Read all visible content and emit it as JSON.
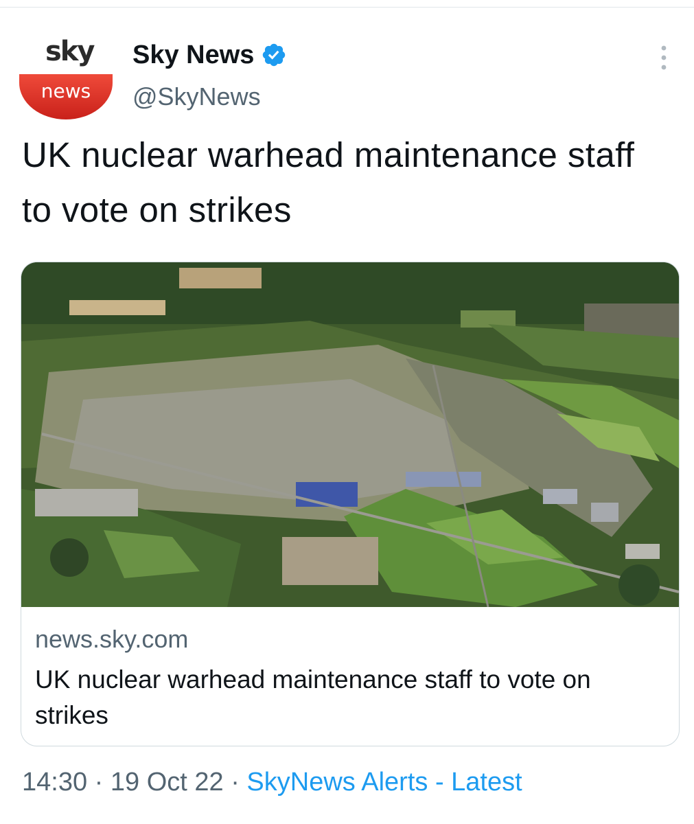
{
  "author": {
    "avatar_logo_top": "sky",
    "avatar_logo_bottom": "news",
    "display_name": "Sky News",
    "handle": "@SkyNews",
    "verified_icon": "verified-badge-icon"
  },
  "tweet": {
    "text": "UK nuclear warhead maintenance staff to vote on strikes"
  },
  "card": {
    "image_description_icon": "aerial-photo",
    "domain": "news.sky.com",
    "title": "UK nuclear warhead maintenance staff to vote on strikes"
  },
  "meta": {
    "time": "14:30",
    "separator": "·",
    "date": "19 Oct 22",
    "source": "SkyNews Alerts - Latest"
  },
  "colors": {
    "link_blue": "#1d9bf0",
    "muted_text": "#536471",
    "brand_red": "#d5251c",
    "verified_blue": "#1d9bf0"
  }
}
